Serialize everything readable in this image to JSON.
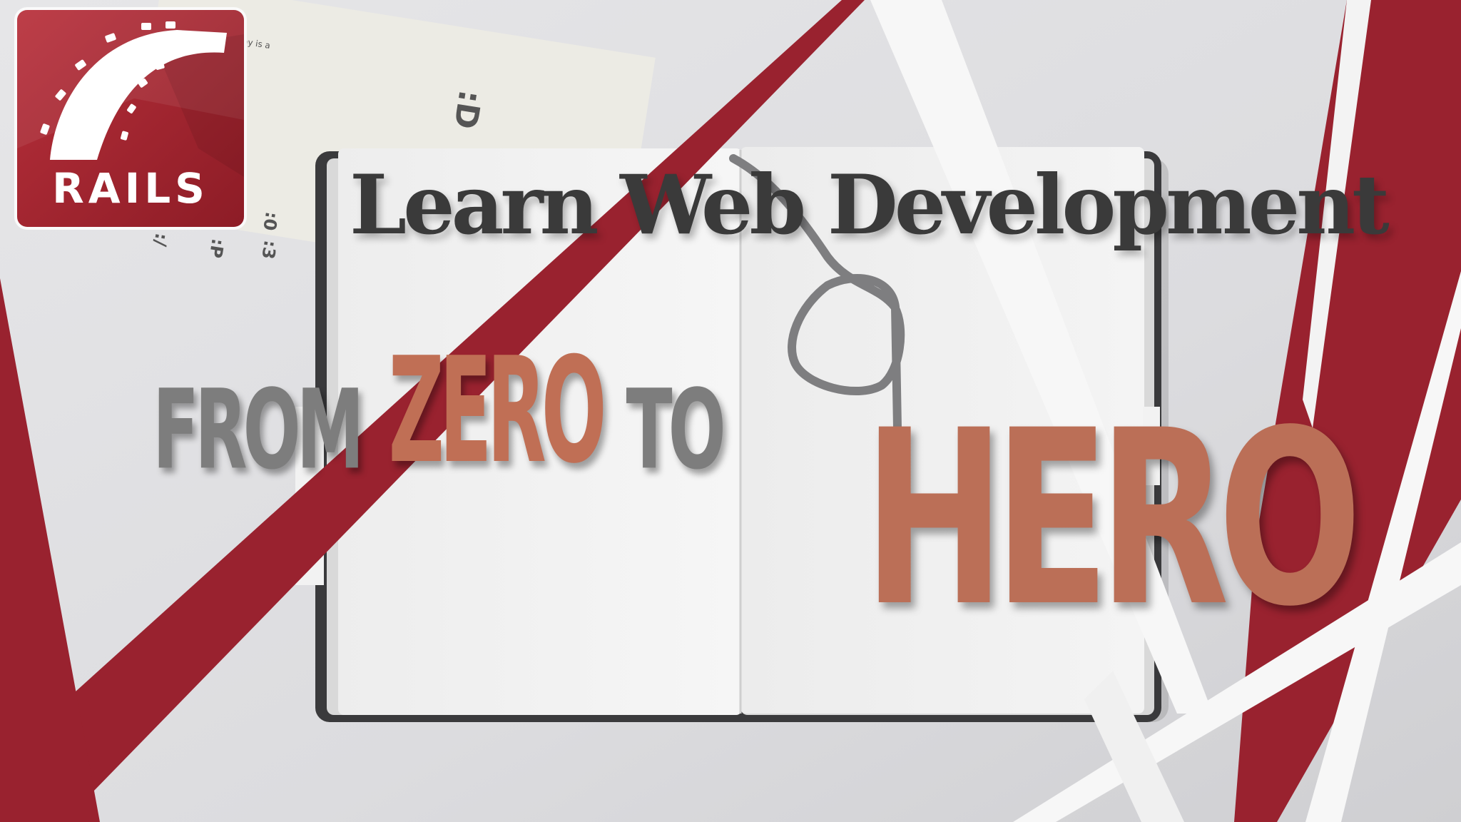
{
  "logo": {
    "word": "RAILS",
    "icon": "rails-track-icon",
    "color": "#a3232f"
  },
  "card": {
    "snippet": "ay is a",
    "emoji_large": ":D",
    "emoji_1": ":3",
    "emoji_2": ":0",
    "emoji_3": ":P",
    "emoji_4": ":/"
  },
  "headline": {
    "title": "Learn Web Development",
    "from": "FROM",
    "zero": "ZERO",
    "to": "TO",
    "hero": "HERO"
  },
  "colors": {
    "accent_red": "#99222f",
    "title_gray": "#3a3a3a",
    "tag_gray": "#7d7d7d",
    "tag_orange": "#c06f55"
  }
}
